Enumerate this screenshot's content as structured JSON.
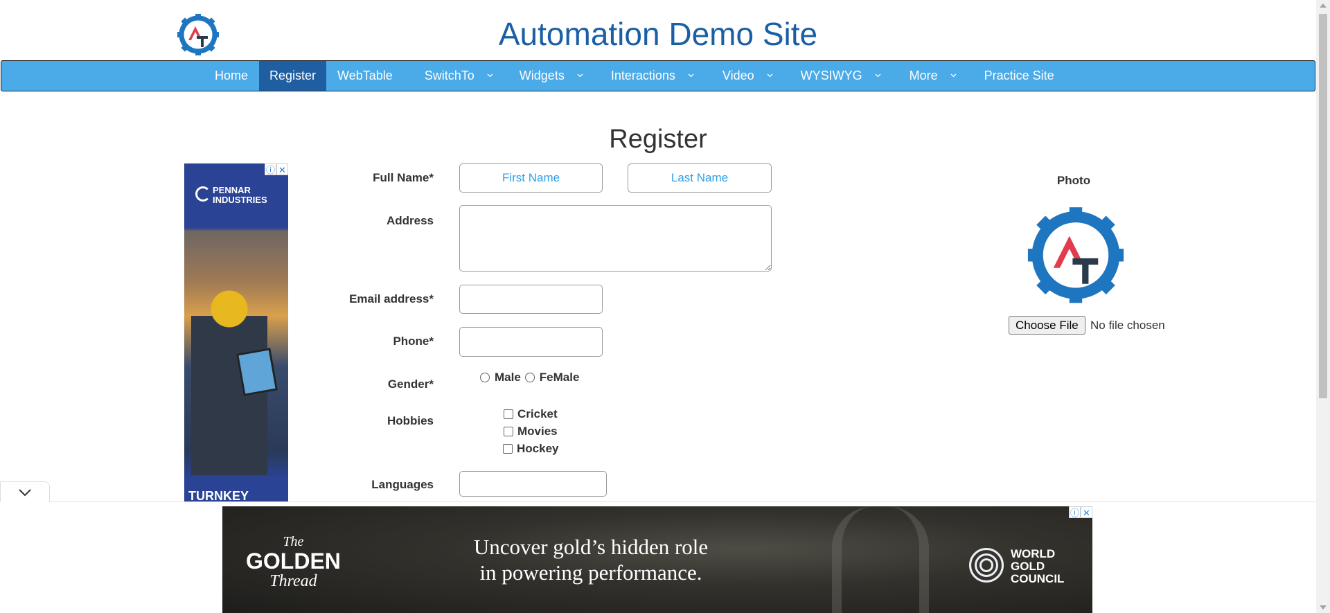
{
  "header": {
    "title": "Automation Demo Site",
    "logo_icon": "automation-testing-gear-logo"
  },
  "nav": {
    "items": [
      {
        "label": "Home",
        "active": false,
        "dropdown": false
      },
      {
        "label": "Register",
        "active": true,
        "dropdown": false
      },
      {
        "label": "WebTable",
        "active": false,
        "dropdown": false
      },
      {
        "label": "SwitchTo",
        "active": false,
        "dropdown": true
      },
      {
        "label": "Widgets",
        "active": false,
        "dropdown": true
      },
      {
        "label": "Interactions",
        "active": false,
        "dropdown": true
      },
      {
        "label": "Video",
        "active": false,
        "dropdown": true
      },
      {
        "label": "WYSIWYG",
        "active": false,
        "dropdown": true
      },
      {
        "label": "More",
        "active": false,
        "dropdown": true
      },
      {
        "label": "Practice Site",
        "active": false,
        "dropdown": false
      }
    ]
  },
  "page": {
    "heading": "Register"
  },
  "form": {
    "full_name_label": "Full Name*",
    "first_name_placeholder": "First Name",
    "last_name_placeholder": "Last Name",
    "first_name_value": "",
    "last_name_value": "",
    "address_label": "Address",
    "address_value": "",
    "email_label": "Email address*",
    "email_value": "",
    "phone_label": "Phone*",
    "phone_value": "",
    "gender_label": "Gender*",
    "gender_options": [
      "Male",
      "FeMale"
    ],
    "hobbies_label": "Hobbies",
    "hobbies": [
      "Cricket",
      "Movies",
      "Hockey"
    ],
    "languages_label": "Languages",
    "languages_value": ""
  },
  "photo": {
    "label": "Photo",
    "choose_file_label": "Choose File",
    "file_status": "No file chosen"
  },
  "ads": {
    "left": {
      "brand_line1": "PENNAR",
      "brand_line2": "INDUSTRIES",
      "bottom_text": "TURNKEY",
      "info_icon": "ⓘ",
      "close_icon": "✕"
    },
    "bottom": {
      "brand_the": "The",
      "brand_golden": "GOLDEN",
      "brand_thread": "Thread",
      "headline_line1": "Uncover gold’s hidden role",
      "headline_line2": "in powering performance.",
      "sponsor_line1": "WORLD",
      "sponsor_line2": "GOLD",
      "sponsor_line3": "COUNCIL",
      "info_icon": "ⓘ",
      "close_icon": "✕"
    }
  },
  "colors": {
    "title": "#1a5fa6",
    "nav_bg": "#4baae8",
    "nav_active": "#1f5fa1",
    "placeholder": "#2ea0e8"
  }
}
